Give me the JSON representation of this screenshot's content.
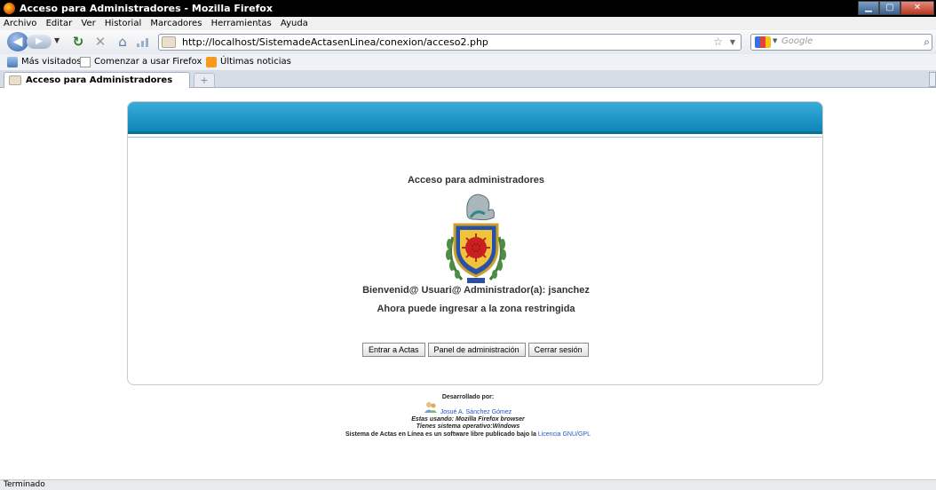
{
  "window": {
    "title": "Acceso para Administradores - Mozilla Firefox",
    "controls": [
      "minimize",
      "maximize",
      "close"
    ]
  },
  "menu": [
    "Archivo",
    "Editar",
    "Ver",
    "Historial",
    "Marcadores",
    "Herramientas",
    "Ayuda"
  ],
  "nav": {
    "url": "http://localhost/SistemadeActasenLinea/conexion/acceso2.php",
    "search_placeholder": "Google",
    "icons": [
      "back-icon",
      "forward-icon",
      "reload-icon",
      "stop-icon",
      "home-icon",
      "signal-bars-icon",
      "star-icon",
      "search-icon"
    ]
  },
  "bookmarks": [
    "Más visitados",
    "Comenzar a usar Firefox",
    "Últimas noticias"
  ],
  "tabs": [
    {
      "label": "Acceso para Administradores"
    }
  ],
  "page": {
    "heading": "Acceso para administradores",
    "welcome": "Bienvenid@ Usuari@ Administrador(a): jsanchez",
    "restricted": "Ahora puede ingresar a la zona restringida",
    "buttons": [
      "Entrar a Actas",
      "Panel de administración",
      "Cerrar sesión"
    ],
    "accent_color": "#1a9ac9"
  },
  "footer": {
    "developed_by": "Desarrollado por:",
    "author": "Josué A. Sánchez Gómez",
    "browser_line": "Estas usando: Mozilla Firefox browser",
    "os_line": "Tienes sistema operativo:Windows",
    "license_text": "Sistema de Actas en Línea es un software libre publicado bajo la",
    "license_link": "Licencia GNU/GPL"
  },
  "status": "Terminado"
}
